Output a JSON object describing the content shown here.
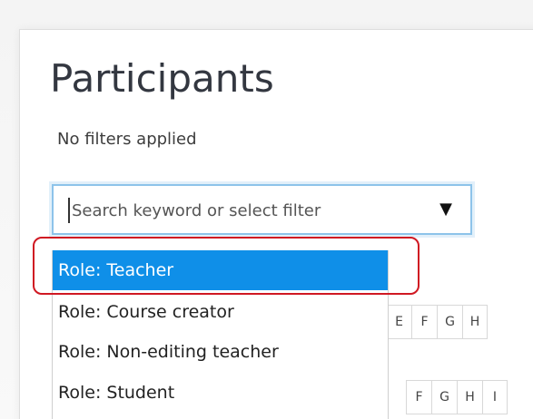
{
  "page": {
    "title": "Participants",
    "filters_status": "No filters applied"
  },
  "search": {
    "placeholder": "Search keyword or select filter",
    "caret": "▼"
  },
  "dropdown": {
    "options": [
      {
        "label": "Role: Teacher",
        "selected": true
      },
      {
        "label": "Role: Course creator",
        "selected": false
      },
      {
        "label": "Role: Non-editing teacher",
        "selected": false
      },
      {
        "label": "Role: Student",
        "selected": false
      }
    ]
  },
  "letters_row_1": [
    "E",
    "F",
    "G",
    "H"
  ],
  "letters_row_2": [
    "F",
    "G",
    "H",
    "I"
  ],
  "colors": {
    "selected_bg": "#0f8fe8",
    "highlight_ring": "#d01822",
    "focus_border": "#8dc3ea"
  }
}
